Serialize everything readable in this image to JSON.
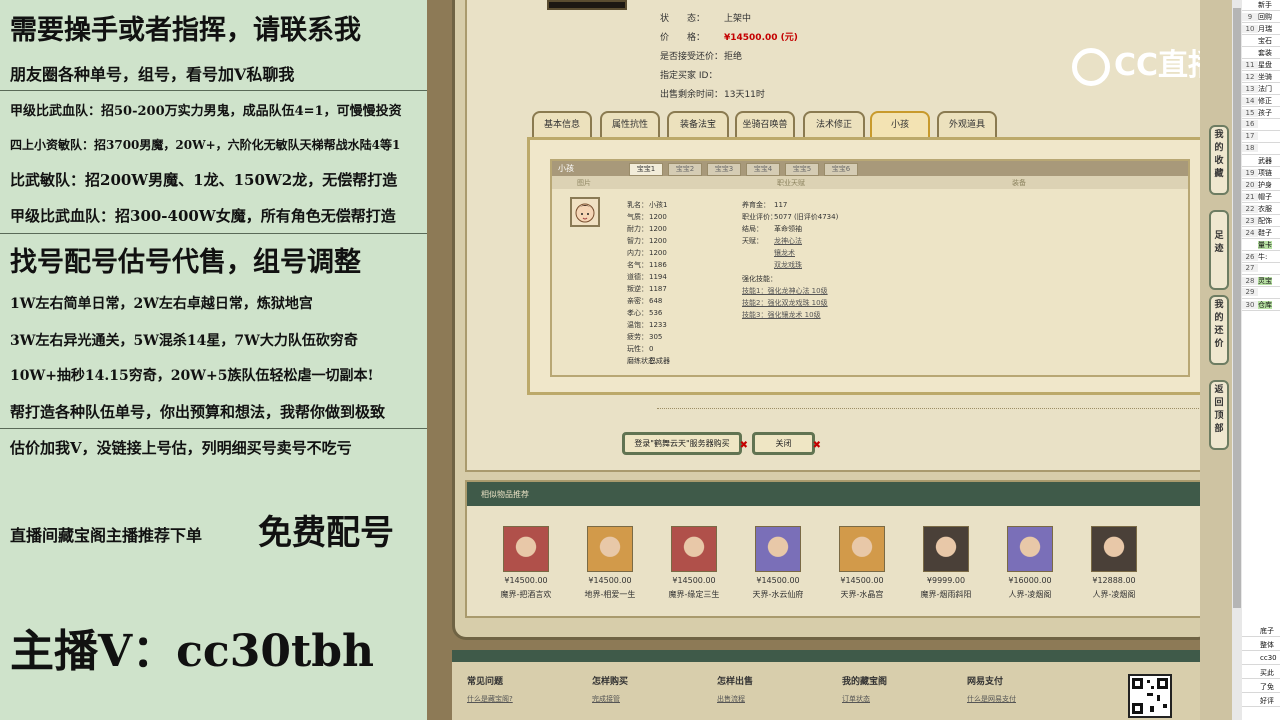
{
  "left_panel": {
    "lines": [
      "需要操手或者指挥，请联系我",
      "朋友圈各种单号，组号，看号加V私聊我",
      "甲级比武血队：招50-200万实力男鬼，成品队伍4=1，可慢慢投资",
      "四上小资敏队：招3700男魔，20W+，六阶化无敏队天梯帮战水陆4等1",
      "比武敏队：招200W男魔、1龙、150W2龙，无偿帮打造",
      "甲级比武血队：招300-400W女魔，所有角色无偿帮打造",
      "找号配号估号代售，组号调整",
      "1W左右简单日常，2W左右卓越日常，炼狱地宫",
      "3W左右异光通关，5W混杀14星，7W大力队伍砍穷奇",
      "10W+抽秒14.15穷奇，20W+5族队伍轻松虐一切副本!",
      "帮打造各种队伍单号，你出预算和想法，我帮你做到极致",
      "估价加我V，没链接上号估，列明细买号卖号不吃亏",
      "直播间藏宝阁主播推荐下单",
      "免费配号",
      "主播V：cc30tbh"
    ]
  },
  "listing": {
    "status_label": "状　　态：",
    "status_value": "上架中",
    "price_label": "价　　格：",
    "price_value": "¥14500.00 (元)",
    "bargain_label": "是否接受还价：",
    "bargain_value": "拒绝",
    "buyer_label": "指定买家 ID：",
    "buyer_value": "",
    "time_label": "出售剩余时间：",
    "time_value": "13天11时"
  },
  "tabs": [
    "基本信息",
    "属性抗性",
    "装备法宝",
    "坐骑召唤兽",
    "法术修正",
    "小孩",
    "外观道具"
  ],
  "child_panel": {
    "title": "小孩",
    "baby_tabs": [
      "宝宝1",
      "宝宝2",
      "宝宝3",
      "宝宝4",
      "宝宝5",
      "宝宝6"
    ],
    "col_headers": [
      "图片",
      "职业天赋",
      "装备"
    ],
    "stats_left": [
      {
        "k": "乳名：",
        "v": "小孩1"
      },
      {
        "k": "气质：",
        "v": "1200"
      },
      {
        "k": "耐力：",
        "v": "1200"
      },
      {
        "k": "智力：",
        "v": "1200"
      },
      {
        "k": "内力：",
        "v": "1200"
      },
      {
        "k": "名气：",
        "v": "1186"
      },
      {
        "k": "道德：",
        "v": "1194"
      },
      {
        "k": "叛逆：",
        "v": "1187"
      },
      {
        "k": "亲密：",
        "v": "648"
      },
      {
        "k": "孝心：",
        "v": "536"
      },
      {
        "k": "温饱：",
        "v": "1233"
      },
      {
        "k": "疲劳：",
        "v": "305"
      },
      {
        "k": "玩性：",
        "v": "0"
      },
      {
        "k": "磨练状态：",
        "v": "已成器"
      }
    ],
    "stats_right": {
      "money_label": "养育金：",
      "money_value": "117",
      "eval_label": "职业评价：",
      "eval_value": "5077 (旧评价4734)",
      "ending_label": "结局：",
      "ending_value": "革命领袖",
      "talent_label": "天赋：",
      "talents": [
        "龙神心法",
        "镶龙术",
        "双龙戏珠"
      ],
      "skills_label": "强化技能：",
      "skills": [
        "技能1：强化龙神心法 10级",
        "技能2：强化双龙戏珠 10级",
        "技能3：强化镶龙术 10级"
      ]
    }
  },
  "buttons": {
    "login_buy": "登录\"鹤舞云天\"服务器购买",
    "close": "关闭"
  },
  "recommend": {
    "title": "相似物品推荐",
    "items": [
      {
        "price": "¥14500.00",
        "name": "魔界-把酒言欢",
        "face": "#b0504a"
      },
      {
        "price": "¥14500.00",
        "name": "地界-相爱一生",
        "face": "#d29a4a"
      },
      {
        "price": "¥14500.00",
        "name": "魔界-缘定三生",
        "face": "#b0504a"
      },
      {
        "price": "¥14500.00",
        "name": "天界-水云仙府",
        "face": "#7a6fb8"
      },
      {
        "price": "¥14500.00",
        "name": "天界-水晶宫",
        "face": "#d29a4a"
      },
      {
        "price": "¥9999.00",
        "name": "魔界-烟雨斜阳",
        "face": "#4a4038"
      },
      {
        "price": "¥16000.00",
        "name": "人界-凌烟阁",
        "face": "#7a6fb8"
      },
      {
        "price": "¥12888.00",
        "name": "人界-凌烟阁",
        "face": "#4a4038"
      }
    ]
  },
  "footer": {
    "cols": [
      "常见问题",
      "怎样购买",
      "怎样出售",
      "我的藏宝阁",
      "网易支付"
    ],
    "links": [
      "什么是藏宝阁?",
      "完成接管",
      "出售流程",
      "订单状态",
      "什么是网易支付"
    ]
  },
  "logo_text": "CC直播",
  "side_nav": [
    "我的收藏",
    "足迹",
    "我的还价",
    "返回顶部"
  ],
  "sheet_rows": [
    {
      "n": "",
      "c": "新手"
    },
    {
      "n": "9",
      "c": "回购"
    },
    {
      "n": "10",
      "c": "月瑞"
    },
    {
      "n": "",
      "c": "宝石"
    },
    {
      "n": "",
      "c": "套装"
    },
    {
      "n": "11",
      "c": "星盘"
    },
    {
      "n": "12",
      "c": "坐骑"
    },
    {
      "n": "13",
      "c": "法门"
    },
    {
      "n": "14",
      "c": "修正"
    },
    {
      "n": "15",
      "c": "孩子"
    },
    {
      "n": "16",
      "c": ""
    },
    {
      "n": "17",
      "c": ""
    },
    {
      "n": "18",
      "c": ""
    },
    {
      "n": "",
      "c": "武器"
    },
    {
      "n": "19",
      "c": "项链"
    },
    {
      "n": "20",
      "c": "护身"
    },
    {
      "n": "21",
      "c": "帽子"
    },
    {
      "n": "22",
      "c": "衣服"
    },
    {
      "n": "23",
      "c": "配饰"
    },
    {
      "n": "24",
      "c": "鞋子"
    },
    {
      "n": "",
      "c": "量卡",
      "green": true
    },
    {
      "n": "26",
      "c": "牛:"
    },
    {
      "n": "27",
      "c": ""
    },
    {
      "n": "28",
      "c": "灵宝",
      "green": true
    },
    {
      "n": "29",
      "c": ""
    },
    {
      "n": "30",
      "c": "仓库",
      "green": true
    }
  ],
  "sheet_bottom": [
    "底子",
    "整体",
    "cc30",
    "买此",
    "了免",
    "好评"
  ],
  "colors": {
    "accent_red": "#c40000",
    "dark_green": "#3f5a49",
    "parchment": "#e9e1c6"
  }
}
